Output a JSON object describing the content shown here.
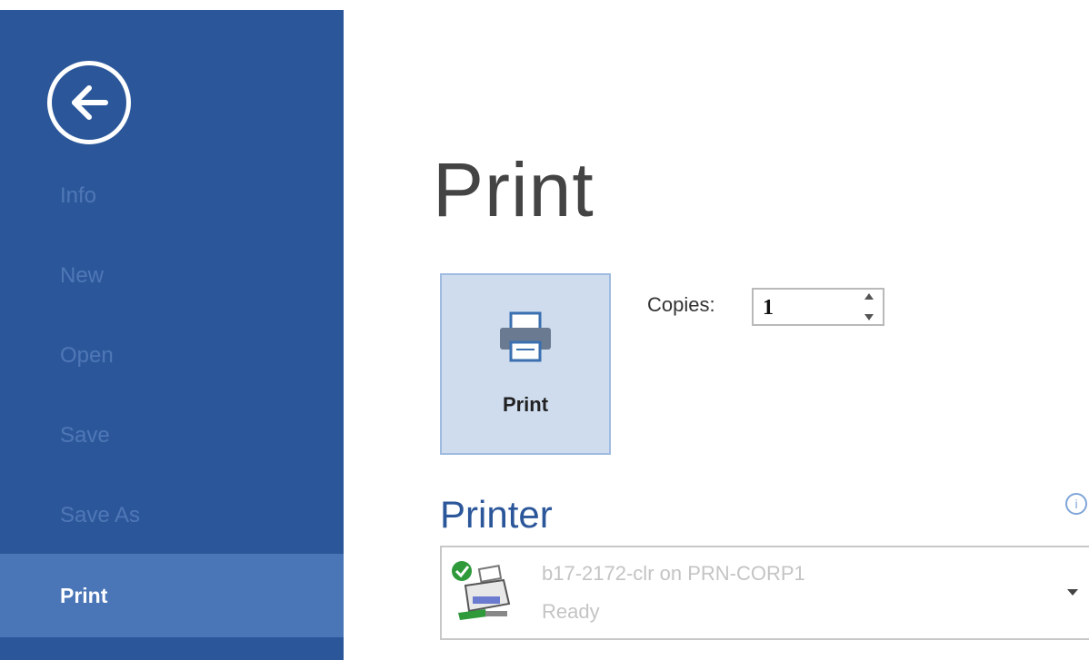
{
  "sidebar": {
    "items": [
      {
        "label": "Info"
      },
      {
        "label": "New"
      },
      {
        "label": "Open"
      },
      {
        "label": "Save"
      },
      {
        "label": "Save As"
      },
      {
        "label": "Print",
        "selected": true
      }
    ]
  },
  "main": {
    "title": "Print",
    "print_button_label": "Print",
    "copies_label": "Copies:",
    "copies_value": "1",
    "printer_heading": "Printer",
    "printer": {
      "name": "b17-2172-clr on PRN-CORP1",
      "status": "Ready"
    }
  },
  "colors": {
    "sidebar_bg": "#2b579a",
    "sidebar_selected_bg": "#4a75b6",
    "accent": "#2b579a",
    "print_button_bg": "#cfdcee"
  },
  "icons": {
    "back": "arrow-left-circle-icon",
    "printer": "printer-icon",
    "printer_device": "printer-ready-icon",
    "info": "info-icon",
    "dropdown": "chevron-down-icon"
  }
}
